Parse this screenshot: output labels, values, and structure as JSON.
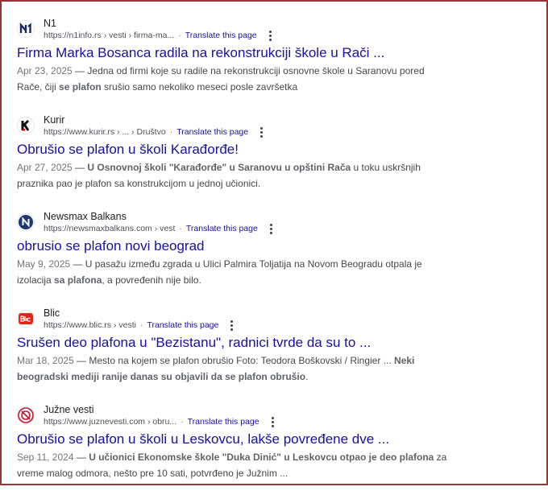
{
  "results": [
    {
      "site": "N1",
      "url": "https://n1info.rs › vesti › firma-ma...",
      "translate": "Translate this page",
      "title": "Firma Marka Bosanca radila na rekonstrukciji škole u Rači ...",
      "date": "Apr 23, 2025",
      "snippet": [
        {
          "t": "Jedna od firmi koje su radile na rekonstrukciji osnovne škole u Saranovu pored Rače, čiji ",
          "b": false
        },
        {
          "t": "se plafon",
          "b": true
        },
        {
          "t": " srušio samo nekoliko meseci posle završetka",
          "b": false
        }
      ],
      "favicon": "n1-logo-icon"
    },
    {
      "site": "Kurir",
      "url": "https://www.kurir.rs › ... › Društvo",
      "translate": "Translate this page",
      "title": "Obrušio se plafon u školi Karađorđe!",
      "date": "Apr 27, 2025",
      "snippet": [
        {
          "t": "U Osnovnoj školi \"Karađorđe\" u Saranovu u opštini Rača",
          "b": true
        },
        {
          "t": " u toku uskršnjih praznika pao je plafon sa konstrukcijom u jednoj učionici.",
          "b": false
        }
      ],
      "favicon": "kurir-logo-icon"
    },
    {
      "site": "Newsmax Balkans",
      "url": "https://newsmaxbalkans.com › vest",
      "translate": "Translate this page",
      "title": "obrusio se plafon novi beograd",
      "date": "May 9, 2025",
      "snippet": [
        {
          "t": "U pasažu između zgrada u Ulici Palmira Toljatija na Novom Beogradu otpala je izolacija ",
          "b": false
        },
        {
          "t": "sa plafona",
          "b": true
        },
        {
          "t": ", a povređenih nije bilo.",
          "b": false
        }
      ],
      "favicon": "newsmax-logo-icon"
    },
    {
      "site": "Blic",
      "url": "https://www.blic.rs › vesti",
      "translate": "Translate this page",
      "title": "Srušen deo plafona u \"Bezistanu\", radnici tvrde da su to ...",
      "date": "Mar 18, 2025",
      "snippet": [
        {
          "t": "Mesto na kojem se plafon obrušio Foto: Teodora Boškovski / Ringier ... ",
          "b": false
        },
        {
          "t": "Neki beogradski mediji ranije danas su objavili da se plafon obrušio",
          "b": true
        },
        {
          "t": ".",
          "b": false
        }
      ],
      "favicon": "blic-logo-icon"
    },
    {
      "site": "Južne vesti",
      "url": "https://www.juznevesti.com › obru...",
      "translate": "Translate this page",
      "title": "Obrušio se plafon u školi u Leskovcu, lakše povređene dve ...",
      "date": "Sep 11, 2024",
      "snippet": [
        {
          "t": "U učionici Ekonomske škole \"Duka Dinić\" u Leskovcu otpao je deo plafona",
          "b": true
        },
        {
          "t": " za vreme malog odmora, nešto pre 10 sati, potvrđeno je Južnim ...",
          "b": false
        }
      ],
      "favicon": "juzne-vesti-logo-icon"
    }
  ]
}
